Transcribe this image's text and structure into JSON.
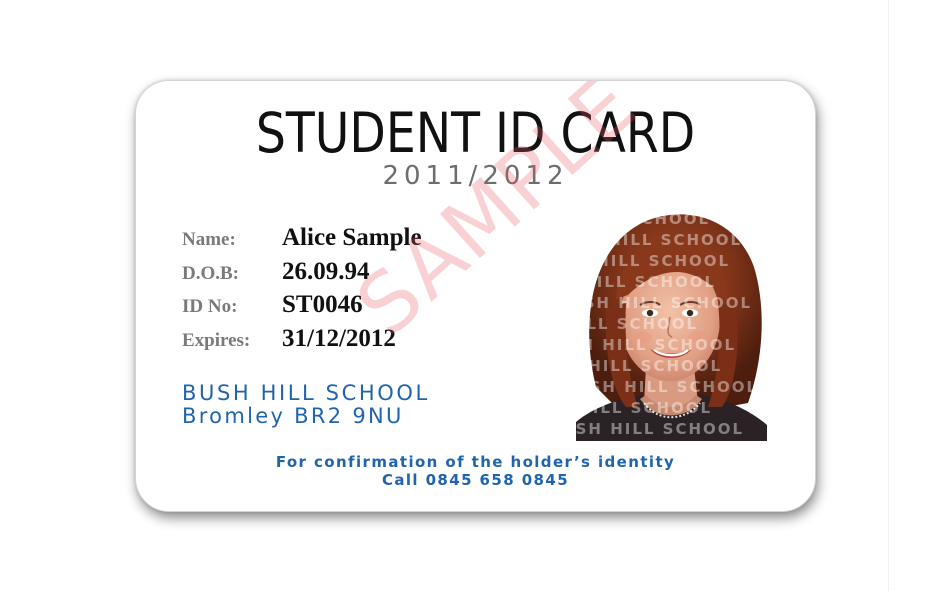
{
  "card": {
    "title": "STUDENT ID CARD",
    "year": "2011/2012",
    "fields": [
      {
        "label": "Name:",
        "value": "Alice Sample"
      },
      {
        "label": "D.O.B:",
        "value": "26.09.94"
      },
      {
        "label": "ID No:",
        "value": "ST0046"
      },
      {
        "label": "Expires:",
        "value": "31/12/2012"
      }
    ],
    "school_name": "BUSH HILL SCHOOL",
    "school_address": "Bromley BR2 9NU",
    "confirmation_text": "For confirmation of the holder’s identity",
    "phone_text": "Call 0845 658 0845",
    "photo_watermark": "BUSH HILL SCHOOL",
    "sample_watermark": "SAMPLE"
  },
  "colors": {
    "title": "#111111",
    "year": "#6d6d6d",
    "label": "#7a7a7a",
    "school_blue": "#1f64ad",
    "sample_red": "#eb5a64"
  }
}
